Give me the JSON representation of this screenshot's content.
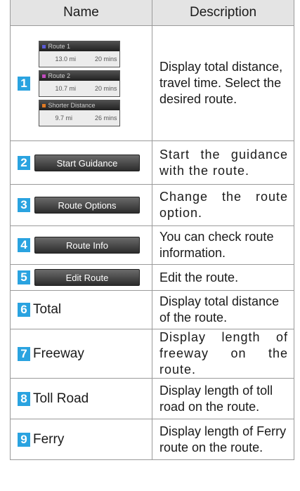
{
  "header": {
    "name": "Name",
    "description": "Description"
  },
  "rows": [
    {
      "num": "1",
      "routes": [
        {
          "name": "Route 1",
          "distance": "13.0 mi",
          "time": "20 mins",
          "color": "#5b5bd6"
        },
        {
          "name": "Route 2",
          "distance": "10.7 mi",
          "time": "20 mins",
          "color": "#c24bbf"
        },
        {
          "name": "Shorter Distance",
          "distance": "9.7 mi",
          "time": "26 mins",
          "color": "#e07a24"
        }
      ],
      "desc": "Display total distance, travel time. Select the desired route."
    },
    {
      "num": "2",
      "button": "Start Guidance",
      "desc": "Start the guidance with the route."
    },
    {
      "num": "3",
      "button": "Route Options",
      "desc": "Change the route option."
    },
    {
      "num": "4",
      "button": "Route Info",
      "desc": "You can check route information."
    },
    {
      "num": "5",
      "button": "Edit Route",
      "desc": "Edit the route."
    },
    {
      "num": "6",
      "label": "Total",
      "desc": "Display total distance of the route."
    },
    {
      "num": "7",
      "label": "Freeway",
      "desc": "Display length of freeway on the route."
    },
    {
      "num": "8",
      "label": "Toll Road",
      "desc": "Display length of toll road on the route."
    },
    {
      "num": "9",
      "label": "Ferry",
      "desc": "Display length of Ferry route on the route."
    }
  ],
  "colors": {
    "number_badge": "#2aa3e0",
    "header_bg": "#e4e4e4"
  }
}
